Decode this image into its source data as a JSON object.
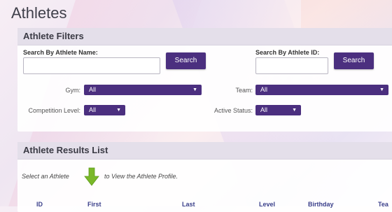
{
  "page": {
    "title": "Athletes"
  },
  "filters": {
    "title": "Athlete Filters",
    "search_name": {
      "label": "Search By Athlete Name:",
      "value": "",
      "button": "Search"
    },
    "search_id": {
      "label": "Search By Athlete ID:",
      "value": "",
      "button": "Search"
    },
    "gym": {
      "label": "Gym:",
      "value": "All"
    },
    "team": {
      "label": "Team:",
      "value": "All"
    },
    "competition_level": {
      "label": "Competition Level:",
      "value": "All"
    },
    "active_status": {
      "label": "Active Status:",
      "value": "All"
    }
  },
  "results": {
    "title": "Athlete Results List",
    "hint_prefix": "Select an Athlete",
    "hint_suffix": "to View the Athlete Profile.",
    "columns": [
      "ID",
      "First",
      "Last",
      "Level",
      "Birthday",
      "Tea"
    ]
  },
  "colors": {
    "accent": "#4b2f7f",
    "arrow": "#7ab829",
    "column_header": "#3a3f8a"
  },
  "icons": {
    "arrow": "green-down-arrow-icon",
    "caret": "caret-down-icon"
  }
}
